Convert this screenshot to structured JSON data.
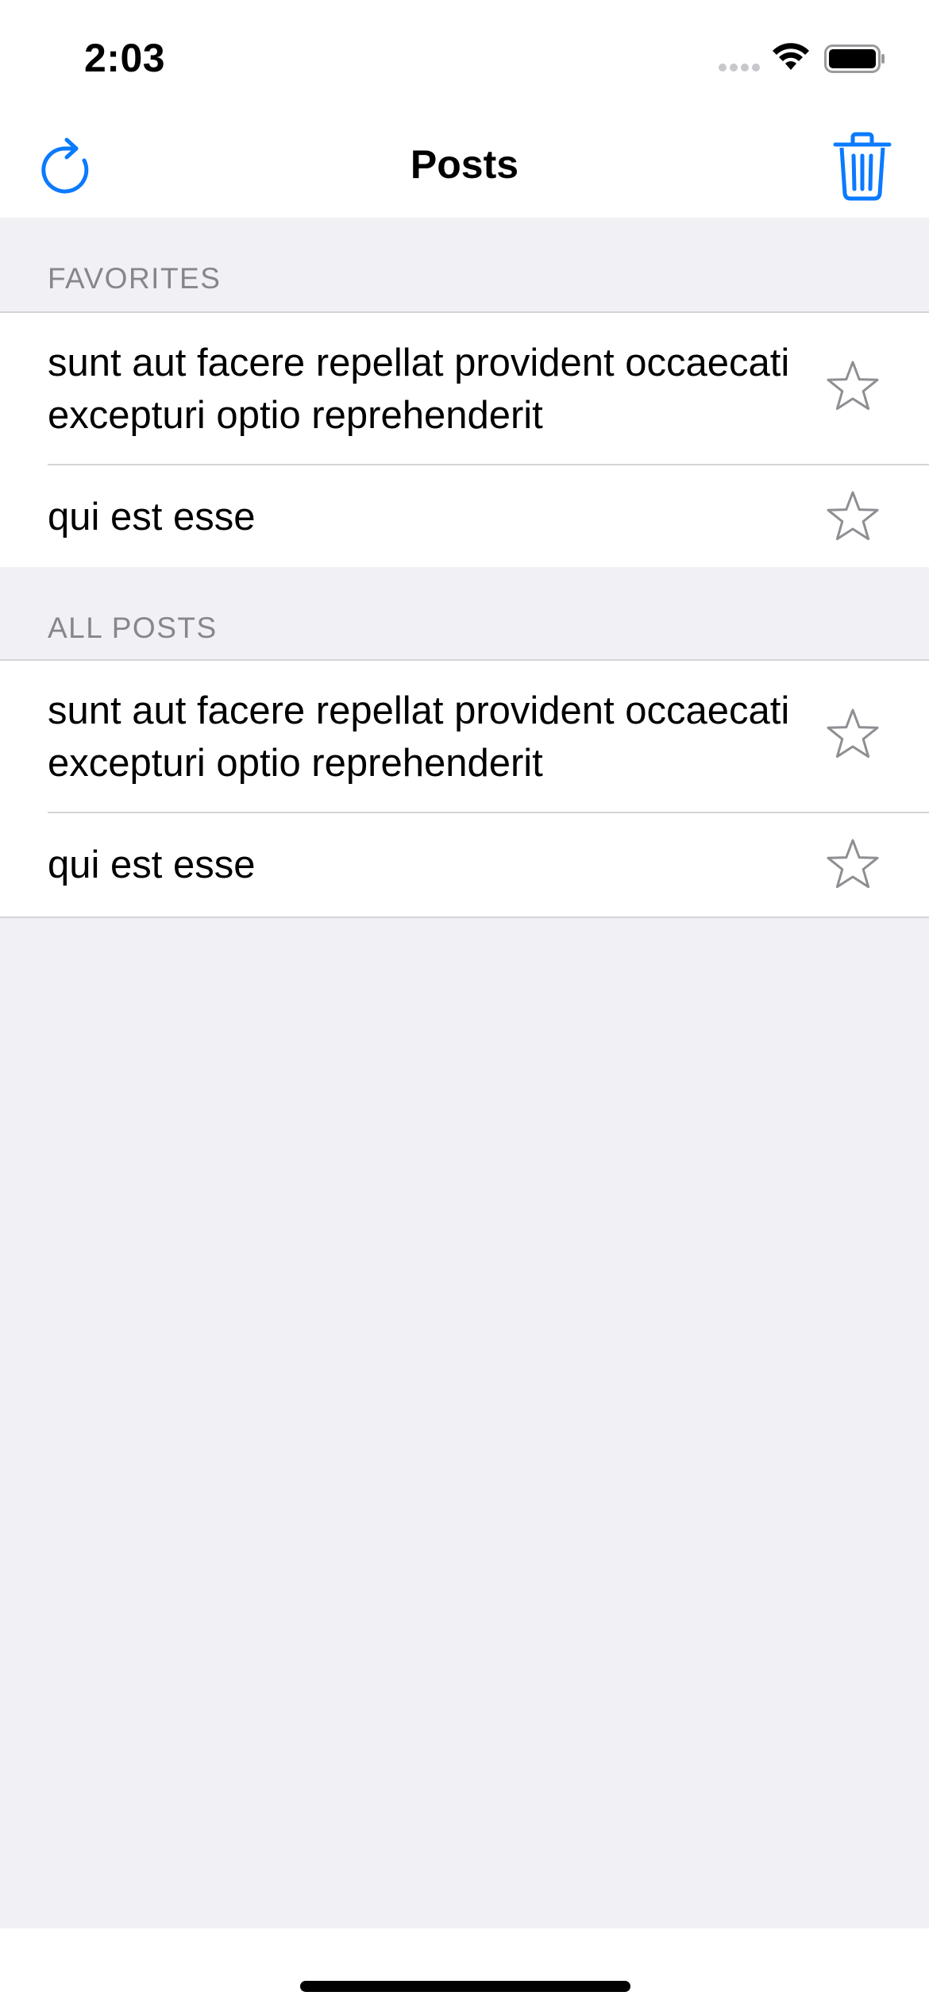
{
  "status_bar": {
    "time": "2:03",
    "icons": [
      "signal-icon",
      "wifi-icon",
      "battery-icon"
    ]
  },
  "nav": {
    "title": "Posts",
    "left_icon": "refresh-icon",
    "right_icon": "trash-icon",
    "accent_color": "#0a7aff"
  },
  "sections": [
    {
      "header": "FAVORITES",
      "rows": [
        {
          "title": "sunt aut facere repellat provident occaecati excepturi optio reprehenderit",
          "starred": false
        },
        {
          "title": "qui est esse",
          "starred": false
        }
      ]
    },
    {
      "header": "ALL POSTS",
      "rows": [
        {
          "title": "sunt aut facere repellat provident occaecati excepturi optio reprehenderit",
          "starred": false
        },
        {
          "title": "qui est esse",
          "starred": false
        }
      ]
    }
  ],
  "colors": {
    "background": "#f0f0f5",
    "section_header_text": "#86868b",
    "star_outline": "#8e8e93",
    "separator": "#d4d4d8"
  }
}
